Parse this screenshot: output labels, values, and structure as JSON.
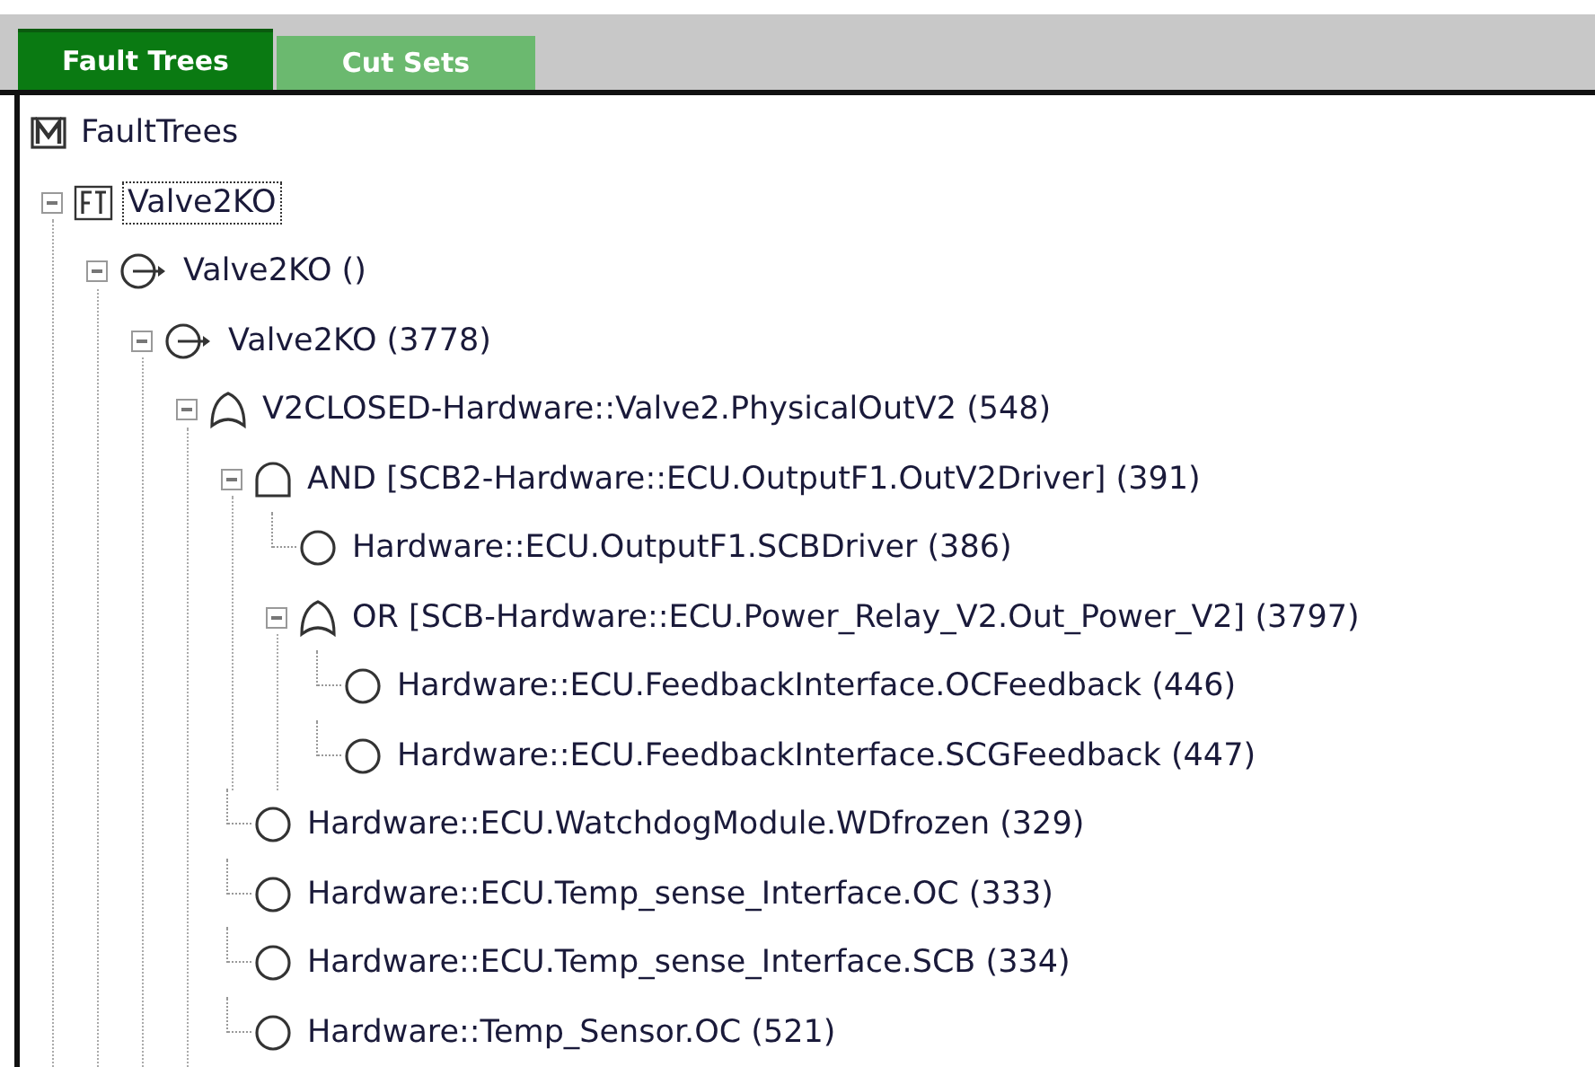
{
  "tabs": [
    {
      "label": "Fault Trees",
      "selected": true
    },
    {
      "label": "Cut Sets",
      "selected": false
    }
  ],
  "tree": [
    {
      "kind": "model",
      "label": "FaultTrees",
      "selected": false,
      "children": [
        {
          "kind": "fault-tree",
          "label": "Valve2KO",
          "selected": true,
          "expanded": true,
          "children": [
            {
              "kind": "transfer",
              "label": "Valve2KO ()",
              "selected": false,
              "expanded": true,
              "children": [
                {
                  "kind": "transfer",
                  "label": "Valve2KO (3778)",
                  "selected": false,
                  "expanded": true,
                  "children": [
                    {
                      "kind": "or",
                      "label": "V2CLOSED-Hardware::Valve2.PhysicalOutV2 (548)",
                      "selected": false,
                      "expanded": true,
                      "children": [
                        {
                          "kind": "and",
                          "label": "AND [SCB2-Hardware::ECU.OutputF1.OutV2Driver] (391)",
                          "selected": false,
                          "expanded": true,
                          "children": [
                            {
                              "kind": "basic",
                              "label": "Hardware::ECU.OutputF1.SCBDriver (386)",
                              "selected": false
                            },
                            {
                              "kind": "or",
                              "label": "OR [SCB-Hardware::ECU.Power_Relay_V2.Out_Power_V2] (3797)",
                              "selected": false,
                              "expanded": true,
                              "children": [
                                {
                                  "kind": "basic",
                                  "label": "Hardware::ECU.FeedbackInterface.OCFeedback (446)",
                                  "selected": false
                                },
                                {
                                  "kind": "basic",
                                  "label": "Hardware::ECU.FeedbackInterface.SCGFeedback (447)",
                                  "selected": false
                                }
                              ]
                            }
                          ]
                        },
                        {
                          "kind": "basic",
                          "label": "Hardware::ECU.WatchdogModule.WDfrozen (329)",
                          "selected": false
                        },
                        {
                          "kind": "basic",
                          "label": "Hardware::ECU.Temp_sense_Interface.OC (333)",
                          "selected": false
                        },
                        {
                          "kind": "basic",
                          "label": "Hardware::ECU.Temp_sense_Interface.SCB (334)",
                          "selected": false
                        },
                        {
                          "kind": "basic",
                          "label": "Hardware::Temp_Sensor.OC (521)",
                          "selected": false
                        }
                      ]
                    }
                  ]
                }
              ]
            }
          ]
        }
      ]
    }
  ]
}
